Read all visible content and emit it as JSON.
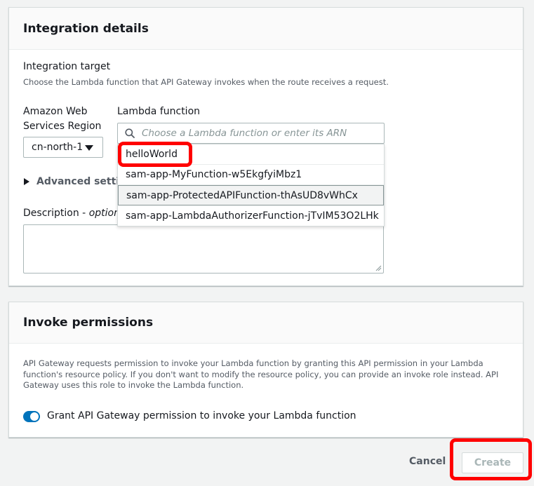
{
  "integration": {
    "title": "Integration details",
    "target_label": "Integration target",
    "target_desc": "Choose the Lambda function that API Gateway invokes when the route receives a request.",
    "region_label_1": "Amazon Web",
    "region_label_2": "Services Region",
    "region_value": "cn-north-1",
    "lambda_label": "Lambda function",
    "lambda_placeholder": "Choose a Lambda function or enter its ARN",
    "options": [
      "helloWorld",
      "sam-app-MyFunction-w5EkgfyiMbz1",
      "sam-app-ProtectedAPIFunction-thAsUD8vWhCx",
      "sam-app-LambdaAuthorizerFunction-jTvIM53O2LHk"
    ],
    "advanced_label": "Advanced setting",
    "description_label": "Description - ",
    "description_optional": "optional"
  },
  "invoke": {
    "title": "Invoke permissions",
    "desc": "API Gateway requests permission to invoke your Lambda function by granting this API permission in your Lambda function's resource policy. If you don't want to modify the resource policy, you can provide an invoke role instead. API Gateway uses this role to invoke the Lambda function.",
    "toggle_label": "Grant API Gateway permission to invoke your Lambda function",
    "toggle_on": true
  },
  "footer": {
    "cancel_label": "Cancel",
    "create_label": "Create"
  },
  "colors": {
    "accent": "#0073bb",
    "highlight": "#ff0000"
  }
}
